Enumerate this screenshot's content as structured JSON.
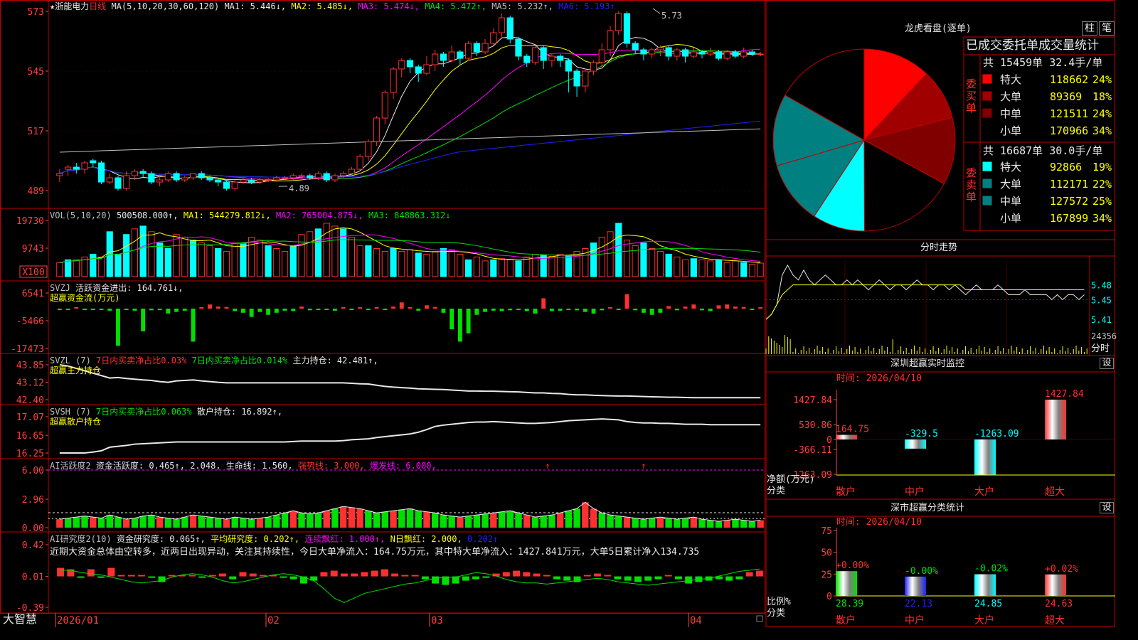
{
  "colors": {
    "up": "#ff3030",
    "down": "#00ffff",
    "green": "#00e000",
    "white": "#e8e8e8",
    "yellow": "#ffff00",
    "magenta": "#ff00ff",
    "blue": "#2020ff",
    "grid": "#c00000",
    "axis": "#ff4040"
  },
  "kline": {
    "star": "★",
    "name": "浙能电力",
    "period": "日线",
    "ma_params": "MA(5,10,20,30,60,120)",
    "ma1": "MA1: 5.446↓,",
    "ma2": "MA2: 5.485↓,",
    "ma3": "MA3: 5.474↓,",
    "ma4": "MA4: 5.472↑,",
    "ma5": "MA5: 5.232↑,",
    "ma6": "MA6: 5.193↑",
    "high_mark": "5.73",
    "low_mark": "4.89",
    "y_ticks": [
      "573",
      "545",
      "517",
      "489"
    ],
    "candles": [
      [
        4.96,
        4.97,
        4.93,
        4.99
      ],
      [
        4.99,
        5.0,
        4.96,
        5.01
      ],
      [
        5.0,
        4.99,
        4.97,
        5.02
      ],
      [
        4.99,
        5.02,
        4.97,
        5.03
      ],
      [
        5.03,
        5.02,
        5.0,
        5.04
      ],
      [
        5.02,
        4.93,
        4.92,
        5.03
      ],
      [
        4.93,
        4.95,
        4.92,
        4.97
      ],
      [
        4.95,
        4.9,
        4.89,
        4.96
      ],
      [
        4.9,
        4.96,
        4.89,
        4.98
      ],
      [
        4.96,
        4.98,
        4.94,
        4.99
      ],
      [
        4.98,
        4.97,
        4.95,
        4.99
      ],
      [
        4.97,
        4.93,
        4.92,
        4.98
      ],
      [
        4.93,
        4.94,
        4.91,
        4.96
      ],
      [
        4.94,
        4.97,
        4.93,
        4.98
      ],
      [
        4.97,
        4.94,
        4.93,
        4.98
      ],
      [
        4.94,
        4.95,
        4.93,
        4.96
      ],
      [
        4.95,
        4.97,
        4.94,
        4.97
      ],
      [
        4.97,
        4.95,
        4.94,
        4.98
      ],
      [
        4.95,
        4.94,
        4.93,
        4.96
      ],
      [
        4.94,
        4.93,
        4.91,
        4.95
      ],
      [
        4.93,
        4.9,
        4.89,
        4.94
      ],
      [
        4.9,
        4.93,
        4.89,
        4.94
      ],
      [
        4.93,
        4.94,
        4.92,
        4.95
      ],
      [
        4.94,
        4.93,
        4.92,
        4.95
      ],
      [
        4.93,
        4.94,
        4.92,
        4.95
      ],
      [
        4.94,
        4.94,
        4.93,
        4.95
      ],
      [
        4.94,
        4.95,
        4.93,
        4.96
      ],
      [
        4.95,
        4.95,
        4.94,
        4.96
      ],
      [
        4.95,
        4.96,
        4.94,
        4.97
      ],
      [
        4.96,
        4.96,
        4.94,
        4.97
      ],
      [
        4.96,
        4.95,
        4.94,
        4.97
      ],
      [
        4.95,
        4.97,
        4.94,
        4.98
      ],
      [
        4.97,
        4.94,
        4.93,
        4.98
      ],
      [
        4.94,
        4.96,
        4.93,
        4.97
      ],
      [
        4.96,
        4.97,
        4.95,
        4.98
      ],
      [
        4.97,
        4.99,
        4.96,
        5.0
      ],
      [
        4.99,
        5.05,
        4.98,
        5.06
      ],
      [
        5.05,
        5.12,
        5.03,
        5.13
      ],
      [
        5.12,
        5.23,
        5.1,
        5.24
      ],
      [
        5.23,
        5.35,
        5.2,
        5.36
      ],
      [
        5.35,
        5.46,
        5.32,
        5.47
      ],
      [
        5.46,
        5.5,
        5.42,
        5.51
      ],
      [
        5.5,
        5.47,
        5.44,
        5.51
      ],
      [
        5.47,
        5.44,
        5.4,
        5.48
      ],
      [
        5.44,
        5.48,
        5.43,
        5.52
      ],
      [
        5.48,
        5.53,
        5.45,
        5.55
      ],
      [
        5.53,
        5.5,
        5.47,
        5.54
      ],
      [
        5.5,
        5.54,
        5.49,
        5.57
      ],
      [
        5.54,
        5.51,
        5.48,
        5.55
      ],
      [
        5.51,
        5.58,
        5.5,
        5.59
      ],
      [
        5.58,
        5.54,
        5.52,
        5.59
      ],
      [
        5.54,
        5.58,
        5.53,
        5.6
      ],
      [
        5.58,
        5.63,
        5.57,
        5.65
      ],
      [
        5.63,
        5.7,
        5.6,
        5.72
      ],
      [
        5.7,
        5.6,
        5.58,
        5.71
      ],
      [
        5.6,
        5.52,
        5.5,
        5.61
      ],
      [
        5.52,
        5.49,
        5.47,
        5.53
      ],
      [
        5.49,
        5.56,
        5.48,
        5.57
      ],
      [
        5.56,
        5.5,
        5.46,
        5.57
      ],
      [
        5.5,
        5.52,
        5.47,
        5.53
      ],
      [
        5.52,
        5.5,
        5.47,
        5.53
      ],
      [
        5.5,
        5.45,
        5.35,
        5.51
      ],
      [
        5.45,
        5.38,
        5.33,
        5.46
      ],
      [
        5.38,
        5.45,
        5.35,
        5.46
      ],
      [
        5.45,
        5.49,
        5.43,
        5.5
      ],
      [
        5.49,
        5.55,
        5.47,
        5.58
      ],
      [
        5.55,
        5.64,
        5.52,
        5.66
      ],
      [
        5.64,
        5.72,
        5.62,
        5.73
      ],
      [
        5.72,
        5.58,
        5.56,
        5.73
      ],
      [
        5.58,
        5.55,
        5.53,
        5.59
      ],
      [
        5.55,
        5.53,
        5.5,
        5.56
      ],
      [
        5.53,
        5.55,
        5.51,
        5.56
      ],
      [
        5.55,
        5.56,
        5.52,
        5.57
      ],
      [
        5.56,
        5.52,
        5.5,
        5.57
      ],
      [
        5.52,
        5.55,
        5.5,
        5.56
      ],
      [
        5.55,
        5.52,
        5.49,
        5.56
      ],
      [
        5.52,
        5.54,
        5.51,
        5.56
      ],
      [
        5.54,
        5.53,
        5.51,
        5.55
      ],
      [
        5.53,
        5.54,
        5.52,
        5.56
      ],
      [
        5.54,
        5.51,
        5.5,
        5.55
      ],
      [
        5.51,
        5.54,
        5.5,
        5.55
      ],
      [
        5.54,
        5.52,
        5.51,
        5.55
      ],
      [
        5.52,
        5.54,
        5.51,
        5.56
      ],
      [
        5.54,
        5.53,
        5.52,
        5.55
      ],
      [
        5.53,
        5.53,
        5.52,
        5.54
      ]
    ]
  },
  "vol": {
    "title": "VOL(5,10,20)",
    "value": "500508.000↑,",
    "ma1": "MA1: 544279.812↓,",
    "ma2": "MA2: 765004.875↓,",
    "ma3": "MA3: 848863.312↓",
    "y_ticks": [
      "19730",
      "9743"
    ],
    "unit": "X100",
    "bars": [
      0.25,
      0.3,
      0.3,
      0.35,
      0.4,
      0.35,
      0.8,
      0.4,
      0.75,
      0.85,
      0.9,
      0.8,
      0.6,
      0.5,
      0.75,
      0.7,
      0.65,
      0.6,
      0.55,
      0.5,
      0.45,
      0.6,
      0.6,
      0.7,
      0.65,
      0.55,
      0.5,
      0.45,
      0.55,
      0.75,
      0.8,
      0.85,
      0.95,
      0.9,
      0.85,
      0.7,
      0.55,
      0.55,
      0.5,
      0.45,
      0.5,
      0.45,
      0.48,
      0.42,
      0.4,
      0.45,
      0.5,
      0.48,
      0.4,
      0.3,
      0.35,
      0.28,
      0.3,
      0.32,
      0.3,
      0.28,
      0.35,
      0.4,
      0.38,
      0.36,
      0.4,
      0.38,
      0.45,
      0.5,
      0.6,
      0.7,
      0.8,
      0.95,
      0.65,
      0.55,
      0.6,
      0.5,
      0.45,
      0.4,
      0.35,
      0.3,
      0.32,
      0.3,
      0.28,
      0.3,
      0.25,
      0.28,
      0.25,
      0.22,
      0.24
    ]
  },
  "svzj": {
    "title": "SVZJ",
    "label": "活跃资金进出:",
    "value": "164.761↓,",
    "name": "超赢资金流(万元)",
    "y_ticks": [
      "6541",
      "-5466",
      "-17473"
    ],
    "bars": [
      -0.02,
      -0.02,
      0.03,
      -0.03,
      -0.02,
      -0.02,
      -0.05,
      -0.9,
      -0.03,
      -0.05,
      -0.55,
      -0.04,
      -0.03,
      -0.12,
      -0.08,
      -0.05,
      -0.8,
      0.02,
      0.1,
      0.05,
      0.04,
      -0.06,
      -0.1,
      -0.2,
      -0.08,
      -0.15,
      -0.1,
      -0.05,
      -0.06,
      0.05,
      -0.04,
      -0.03,
      -0.02,
      -0.05,
      0.03,
      -0.03,
      0.02,
      -0.02,
      0.02,
      -0.02,
      0.05,
      0.15,
      0.03,
      -0.05,
      0.08,
      0.04,
      -0.1,
      -0.5,
      -0.8,
      -0.6,
      -0.15,
      -0.08,
      -0.05,
      -0.06,
      -0.04,
      -0.03,
      -0.06,
      -0.12,
      0.25,
      -0.06,
      -0.05,
      -0.03,
      -0.04,
      -0.08,
      -0.12,
      -0.04,
      0.02,
      -0.03,
      0.35,
      -0.04,
      -0.1,
      -0.15,
      -0.1,
      0.06,
      -0.04,
      0.05,
      0.1,
      -0.04,
      -0.06,
      0.08,
      0.1,
      0.05,
      0.04,
      -0.02,
      0.03
    ]
  },
  "svzl": {
    "title": "SVZL (7)",
    "ratio1": "7日内买卖净占比0.03%",
    "ratio2": "7日内买卖净占比0.014%",
    "label": "主力持仓:",
    "value": "42.481↑,",
    "name": "超赢主力持仓",
    "y_ticks": [
      "43.85",
      "43.12",
      "42.40"
    ],
    "line": [
      43.85,
      43.8,
      43.7,
      43.6,
      43.5,
      43.4,
      43.3,
      43.32,
      43.28,
      43.25,
      43.22,
      43.2,
      43.15,
      43.12,
      43.18,
      43.2,
      43.22,
      43.18,
      43.15,
      43.12,
      43.1,
      43.1,
      43.1,
      43.1,
      43.1,
      43.1,
      43.1,
      43.1,
      43.1,
      43.1,
      43.1,
      43.1,
      43.1,
      43.1,
      43.1,
      43.08,
      43.06,
      43.05,
      43.0,
      42.95,
      42.92,
      42.9,
      42.88,
      42.85,
      42.84,
      42.83,
      42.82,
      42.8,
      42.78,
      42.76,
      42.76,
      42.75,
      42.75,
      42.74,
      42.73,
      42.72,
      42.7,
      42.68,
      42.68,
      42.66,
      42.65,
      42.62,
      42.6,
      42.6,
      42.58,
      42.57,
      42.56,
      42.55,
      42.55,
      42.54,
      42.53,
      42.52,
      42.51,
      42.5,
      42.5,
      42.49,
      42.48,
      42.48,
      42.48,
      42.48,
      42.48,
      42.48,
      42.48,
      42.48,
      42.48
    ]
  },
  "svsh": {
    "title": "SVSH (7)",
    "ratio1": "7日内买卖净占比0.063%",
    "label": "散户持仓:",
    "value": "16.892↑,",
    "name": "超赢散户持仓",
    "y_ticks": [
      "17.07",
      "16.65",
      "16.25"
    ],
    "line": [
      16.25,
      16.25,
      16.25,
      16.25,
      16.27,
      16.3,
      16.38,
      16.4,
      16.42,
      16.45,
      16.46,
      16.47,
      16.48,
      16.49,
      16.5,
      16.5,
      16.5,
      16.5,
      16.5,
      16.5,
      16.5,
      16.5,
      16.5,
      16.5,
      16.5,
      16.5,
      16.5,
      16.5,
      16.51,
      16.52,
      16.52,
      16.52,
      16.52,
      16.52,
      16.53,
      16.55,
      16.56,
      16.57,
      16.6,
      16.62,
      16.64,
      16.66,
      16.68,
      16.72,
      16.78,
      16.85,
      16.88,
      16.9,
      16.92,
      16.94,
      16.95,
      16.95,
      16.96,
      16.95,
      16.94,
      16.93,
      16.92,
      16.92,
      16.93,
      16.94,
      16.96,
      16.98,
      16.99,
      17.0,
      17.01,
      17.02,
      17.01,
      17.0,
      16.96,
      16.94,
      16.93,
      16.93,
      16.92,
      16.92,
      16.91,
      16.9,
      16.9,
      16.9,
      16.89,
      16.89,
      16.89,
      16.89,
      16.89,
      16.89,
      16.89
    ]
  },
  "ai_active": {
    "title": "AI活跃度2",
    "label": "资金活跃度:",
    "value": "0.465↑,",
    "value2": "2.048,",
    "life_label": "生命线:",
    "life_value": "1.560,",
    "strong": "强势线: 3.000,",
    "burst": "爆发线: 6.000,",
    "y_ticks": [
      "6.00",
      "2.96",
      "0.00"
    ],
    "bars": [
      0.4,
      0.45,
      0.5,
      0.55,
      0.5,
      0.45,
      0.6,
      0.5,
      0.4,
      0.45,
      0.55,
      0.6,
      0.5,
      0.45,
      0.4,
      0.5,
      0.6,
      0.55,
      0.5,
      0.45,
      0.4,
      0.5,
      0.45,
      0.4,
      0.45,
      0.5,
      0.6,
      0.7,
      0.8,
      0.7,
      0.65,
      0.7,
      0.8,
      0.9,
      1.0,
      0.95,
      0.9,
      0.8,
      0.7,
      0.75,
      0.8,
      0.85,
      0.9,
      0.8,
      0.75,
      0.7,
      0.6,
      0.55,
      0.5,
      0.55,
      0.6,
      0.65,
      0.7,
      0.75,
      0.8,
      0.7,
      0.6,
      0.5,
      0.55,
      0.6,
      0.7,
      0.8,
      0.9,
      1.2,
      0.9,
      0.7,
      0.6,
      0.55,
      0.5,
      0.45,
      0.4,
      0.45,
      0.5,
      0.45,
      0.4,
      0.45,
      0.5,
      0.4,
      0.35,
      0.3,
      0.35,
      0.4,
      0.35,
      0.3,
      0.35
    ]
  },
  "ai_research": {
    "title": "AI研究度2(10)",
    "label": "资金研究度:",
    "value": "0.065↑,",
    "avg": "平均研究度: 0.202↑,",
    "red": "连续飘红: 1.000↑,",
    "nred": "N日飘红: 2.000,",
    "v4": "0.202↑",
    "comment": "近期大资金总体由空转多，近两日出现异动，关注其持续性，今日大单净流入：164.75万元，其中特大单净流入：1427.841万元，大单5日累计净入134.735",
    "y_ticks": [
      "0.42",
      "0.01",
      "-0.39"
    ],
    "bars": [
      0.06,
      0.05,
      -0.01,
      0.05,
      -0.01,
      0.06,
      0.01,
      0.01,
      0.01,
      -0.01,
      -0.04,
      0.01,
      0.0,
      0.01,
      -0.01,
      0.01,
      0.02,
      -0.02,
      0.03,
      0.02,
      0.01,
      0.0,
      -0.01,
      -0.02,
      -0.05,
      -0.03,
      0.03,
      0.04,
      0.02,
      0.02,
      0.03,
      0.04,
      0.05,
      0.02,
      0.01,
      0.0,
      -0.02,
      -0.05,
      -0.06,
      -0.05,
      -0.03,
      -0.02,
      -0.01,
      0.02,
      0.03,
      0.04,
      0.03,
      0.02,
      0.01,
      -0.02,
      -0.03,
      -0.04,
      0.01,
      0.02,
      0.0,
      -0.02,
      -0.03,
      -0.04,
      -0.03,
      -0.02,
      0.01,
      -0.02,
      -0.05,
      -0.04,
      -0.03,
      -0.02,
      -0.03,
      -0.02,
      0.03,
      0.04
    ]
  },
  "x_axis": {
    "brand": "大智慧",
    "dates": [
      "2026/01",
      "02",
      "03",
      "04"
    ]
  },
  "pie": {
    "title": "龙虎看盘(逐单)",
    "btn_bar": "柱",
    "btn_pen": "笔",
    "table_title": "已成交委托单成交量统计",
    "buy_side": "委买单",
    "sell_side": "委卖单",
    "buy_total": "共 15459单 32.4手/单",
    "sell_total": "共 16687单 30.0手/单",
    "buy_rows": [
      {
        "name": "特大",
        "value": "118662",
        "pct": "24%",
        "color": "#ff0000"
      },
      {
        "name": "大单",
        "value": "89369",
        "pct": "18%",
        "color": "#a00000"
      },
      {
        "name": "中单",
        "value": "121511",
        "pct": "24%",
        "color": "#800000"
      },
      {
        "name": "小单",
        "value": "170966",
        "pct": "34%",
        "color": "#000000"
      }
    ],
    "sell_rows": [
      {
        "name": "特大",
        "value": "92866",
        "pct": "19%",
        "color": "#00ffff"
      },
      {
        "name": "大单",
        "value": "112171",
        "pct": "22%",
        "color": "#008080"
      },
      {
        "name": "中单",
        "value": "127572",
        "pct": "25%",
        "color": "#008080"
      },
      {
        "name": "小单",
        "value": "167899",
        "pct": "34%",
        "color": "#000000"
      }
    ]
  },
  "intraday": {
    "title": "分时走势",
    "price_ticks": [
      "5.48",
      "5.45",
      "5.41"
    ],
    "vol_tick": "24356",
    "vol_unit": "分时",
    "price": [
      5.41,
      5.42,
      5.44,
      5.5,
      5.52,
      5.5,
      5.49,
      5.51,
      5.49,
      5.48,
      5.49,
      5.5,
      5.49,
      5.48,
      5.48,
      5.49,
      5.48,
      5.49,
      5.48,
      5.47,
      5.48,
      5.49,
      5.48,
      5.47,
      5.48,
      5.48,
      5.47,
      5.48,
      5.49,
      5.48,
      5.48,
      5.47,
      5.48,
      5.48,
      5.47,
      5.48,
      5.47,
      5.46,
      5.47,
      5.48,
      5.47,
      5.47,
      5.47,
      5.48,
      5.47,
      5.46,
      5.46,
      5.46,
      5.47,
      5.46,
      5.46,
      5.46,
      5.46,
      5.45,
      5.46,
      5.45,
      5.46,
      5.46,
      5.45,
      5.46
    ],
    "avg": [
      5.41,
      5.42,
      5.44,
      5.46,
      5.47,
      5.48,
      5.48,
      5.48,
      5.48,
      5.48,
      5.48,
      5.48,
      5.48,
      5.48,
      5.48,
      5.48,
      5.48,
      5.48,
      5.48,
      5.48,
      5.48,
      5.48,
      5.48,
      5.48,
      5.48,
      5.48,
      5.48,
      5.48,
      5.48,
      5.48,
      5.48,
      5.48,
      5.48,
      5.48,
      5.48,
      5.48,
      5.48,
      5.47,
      5.47,
      5.47,
      5.47,
      5.47,
      5.47,
      5.47,
      5.47,
      5.47,
      5.47,
      5.47,
      5.47,
      5.47,
      5.47,
      5.47,
      5.47,
      5.47,
      5.47,
      5.47,
      5.47,
      5.47,
      5.47,
      5.47
    ]
  },
  "sz_monitor": {
    "title": "深圳超赢实时监控",
    "time": "时间: 2026/04/10",
    "y_ticks": [
      "1427.84",
      "530.86",
      "0",
      "-366.11",
      "-1263.09"
    ],
    "ylabel": "净额(万元)",
    "xlabel": "分类",
    "bars": [
      {
        "name": "散户",
        "value": 164.75,
        "label": "164.75",
        "color": "#ff3030"
      },
      {
        "name": "中户",
        "value": -329.5,
        "label": "-329.5",
        "color": "#00ffff"
      },
      {
        "name": "大户",
        "value": -1263.09,
        "label": "-1263.09",
        "color": "#00ffff"
      },
      {
        "name": "超大",
        "value": 1427.84,
        "label": "1427.84",
        "color": "#ff3030"
      }
    ],
    "set": "设"
  },
  "sz_class": {
    "title": "深市超赢分类统计",
    "time": "时间: 2026/04/10",
    "y_ticks": [
      "75",
      "50",
      "25",
      "0"
    ],
    "ylabel": "比例%",
    "xlabel": "分类",
    "bars": [
      {
        "name": "散户",
        "value": 28.39,
        "label": "28.39",
        "change": "+0.00%",
        "color": "#ff3030",
        "fill": "#00e000"
      },
      {
        "name": "中户",
        "value": 22.13,
        "label": "22.13",
        "change": "-0.00%",
        "color": "#00e000",
        "fill": "#2020ff"
      },
      {
        "name": "大户",
        "value": 24.85,
        "label": "24.85",
        "change": "-0.02%",
        "color": "#00e000",
        "fill": "#00ffff"
      },
      {
        "name": "超大",
        "value": 24.63,
        "label": "24.63",
        "change": "+0.02%",
        "color": "#ff3030",
        "fill": "#ff3030"
      }
    ],
    "set": "设"
  }
}
